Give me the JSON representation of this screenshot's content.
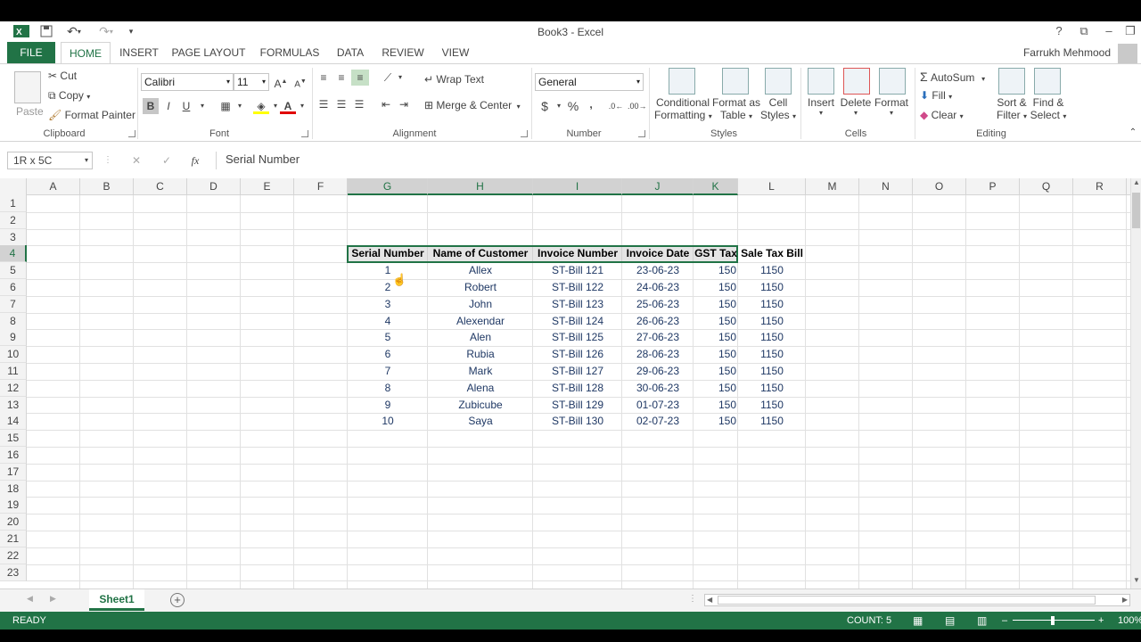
{
  "window": {
    "title": "Book3 - Excel",
    "user": "Farrukh Mehmood"
  },
  "tabs": [
    "FILE",
    "HOME",
    "INSERT",
    "PAGE LAYOUT",
    "FORMULAS",
    "DATA",
    "REVIEW",
    "VIEW"
  ],
  "ribbon": {
    "clipboard": {
      "paste": "Paste",
      "cut": "Cut",
      "copy": "Copy",
      "format_painter": "Format Painter",
      "label": "Clipboard"
    },
    "font": {
      "name": "Calibri",
      "size": "11",
      "bold": "B",
      "italic": "I",
      "underline": "U",
      "label": "Font"
    },
    "alignment": {
      "wrap_text": "Wrap Text",
      "merge_center": "Merge & Center",
      "label": "Alignment"
    },
    "number": {
      "format": "General",
      "currency": "$",
      "percent": "%",
      "comma": ",",
      "label": "Number"
    },
    "styles": {
      "conditional": "Conditional",
      "conditional2": "Formatting",
      "format_as": "Format as",
      "format_as2": "Table",
      "cell": "Cell",
      "cell2": "Styles",
      "label": "Styles"
    },
    "cells": {
      "insert": "Insert",
      "delete": "Delete",
      "format": "Format",
      "label": "Cells"
    },
    "editing": {
      "autosum": "AutoSum",
      "fill": "Fill",
      "clear": "Clear",
      "sort": "Sort &",
      "sort2": "Filter",
      "find": "Find &",
      "find2": "Select",
      "label": "Editing"
    }
  },
  "formula_bar": {
    "name_box": "1R x 5C",
    "fx": "fx",
    "content": "Serial Number"
  },
  "columns": [
    "A",
    "B",
    "C",
    "D",
    "E",
    "F",
    "G",
    "H",
    "I",
    "J",
    "K",
    "L",
    "M",
    "N",
    "O",
    "P",
    "Q",
    "R"
  ],
  "rows": [
    "1",
    "2",
    "3",
    "4",
    "5",
    "6",
    "7",
    "8",
    "9",
    "10",
    "11",
    "12",
    "13",
    "14",
    "15",
    "16",
    "17",
    "18",
    "19",
    "20",
    "21",
    "22",
    "23"
  ],
  "table": {
    "headers": [
      "Serial Number",
      "Name of Customer",
      "Invoice Number",
      "Invoice Date",
      "GST Tax",
      "Sale Tax Bill"
    ],
    "rows": [
      [
        "1",
        "Allex",
        "ST-Bill 121",
        "23-06-23",
        "150",
        "1150"
      ],
      [
        "2",
        "Robert",
        "ST-Bill 122",
        "24-06-23",
        "150",
        "1150"
      ],
      [
        "3",
        "John",
        "ST-Bill 123",
        "25-06-23",
        "150",
        "1150"
      ],
      [
        "4",
        "Alexendar",
        "ST-Bill 124",
        "26-06-23",
        "150",
        "1150"
      ],
      [
        "5",
        "Alen",
        "ST-Bill 125",
        "27-06-23",
        "150",
        "1150"
      ],
      [
        "6",
        "Rubia",
        "ST-Bill 126",
        "28-06-23",
        "150",
        "1150"
      ],
      [
        "7",
        "Mark",
        "ST-Bill 127",
        "29-06-23",
        "150",
        "1150"
      ],
      [
        "8",
        "Alena",
        "ST-Bill 128",
        "30-06-23",
        "150",
        "1150"
      ],
      [
        "9",
        "Zubicube",
        "ST-Bill 129",
        "01-07-23",
        "150",
        "1150"
      ],
      [
        "10",
        "Saya",
        "ST-Bill 130",
        "02-07-23",
        "150",
        "1150"
      ]
    ]
  },
  "sheet": {
    "name": "Sheet1"
  },
  "status": {
    "mode": "READY",
    "count": "COUNT: 5",
    "zoom": "100%"
  },
  "colors": {
    "accent": "#217346"
  }
}
